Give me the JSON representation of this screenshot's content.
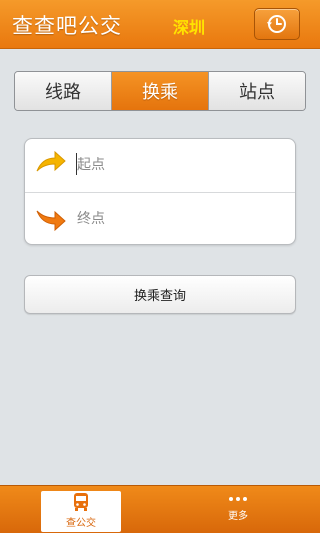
{
  "header": {
    "app_title": "查查吧公交",
    "city": "深圳"
  },
  "tabs": [
    {
      "label": "线路",
      "active": false
    },
    {
      "label": "换乘",
      "active": true
    },
    {
      "label": "站点",
      "active": false
    }
  ],
  "form": {
    "start_placeholder": "起点",
    "start_value": "",
    "end_placeholder": "终点",
    "end_value": ""
  },
  "query_button": {
    "label": "换乘查询"
  },
  "bottom_nav": [
    {
      "label": "查公交",
      "icon": "bus-icon",
      "active": true
    },
    {
      "label": "更多",
      "icon": "more-dots-icon",
      "active": false
    }
  ],
  "colors": {
    "accent": "#ef8414",
    "city_text": "#ffe400",
    "background": "#dfe3e6"
  }
}
